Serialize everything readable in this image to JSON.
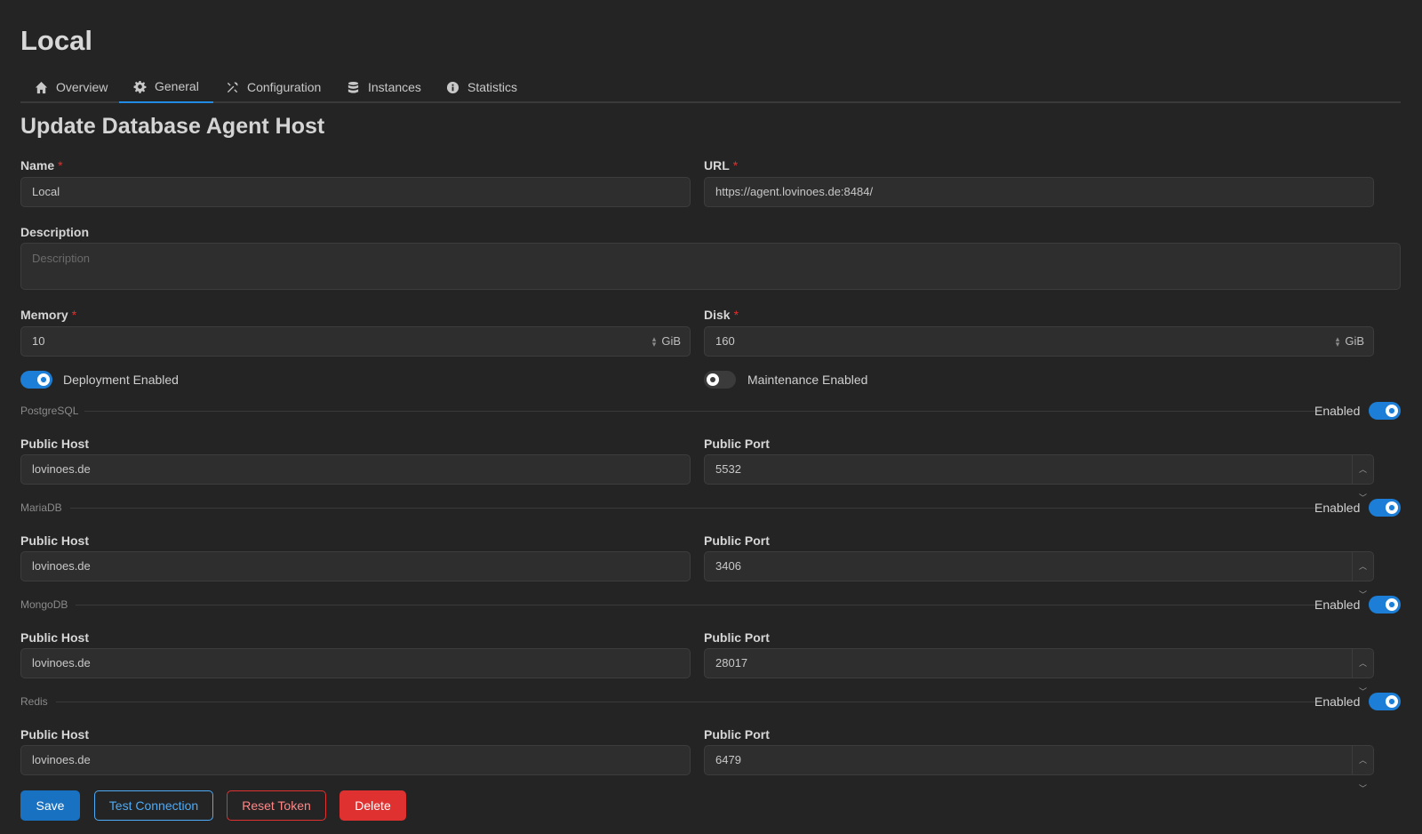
{
  "page": {
    "title": "Local"
  },
  "tabs": [
    {
      "label": "Overview",
      "icon": "home-icon"
    },
    {
      "label": "General",
      "icon": "gear-icon",
      "active": true
    },
    {
      "label": "Configuration",
      "icon": "tools-icon"
    },
    {
      "label": "Instances",
      "icon": "database-icon"
    },
    {
      "label": "Statistics",
      "icon": "info-icon"
    }
  ],
  "form": {
    "title": "Update Database Agent Host",
    "required_mark": "*",
    "name": {
      "label": "Name",
      "value": "Local"
    },
    "url": {
      "label": "URL",
      "value": "https://agent.lovinoes.de:8484/"
    },
    "description": {
      "label": "Description",
      "placeholder": "Description",
      "value": ""
    },
    "memory": {
      "label": "Memory",
      "value": "10",
      "unit": "GiB"
    },
    "disk": {
      "label": "Disk",
      "value": "160",
      "unit": "GiB"
    },
    "deployment": {
      "label": "Deployment Enabled",
      "enabled": true
    },
    "maintenance": {
      "label": "Maintenance Enabled",
      "enabled": false
    }
  },
  "databases": [
    {
      "name": "PostgreSQL",
      "enabled_label": "Enabled",
      "enabled": true,
      "host_label": "Public Host",
      "host": "lovinoes.de",
      "port_label": "Public Port",
      "port": "5532"
    },
    {
      "name": "MariaDB",
      "enabled_label": "Enabled",
      "enabled": true,
      "host_label": "Public Host",
      "host": "lovinoes.de",
      "port_label": "Public Port",
      "port": "3406"
    },
    {
      "name": "MongoDB",
      "enabled_label": "Enabled",
      "enabled": true,
      "host_label": "Public Host",
      "host": "lovinoes.de",
      "port_label": "Public Port",
      "port": "28017"
    },
    {
      "name": "Redis",
      "enabled_label": "Enabled",
      "enabled": true,
      "host_label": "Public Host",
      "host": "lovinoes.de",
      "port_label": "Public Port",
      "port": "6479"
    }
  ],
  "actions": {
    "save": "Save",
    "test_connection": "Test Connection",
    "reset_token": "Reset Token",
    "delete": "Delete"
  },
  "colors": {
    "background": "#242424",
    "accent": "#1c7ed6",
    "danger": "#e03131"
  }
}
